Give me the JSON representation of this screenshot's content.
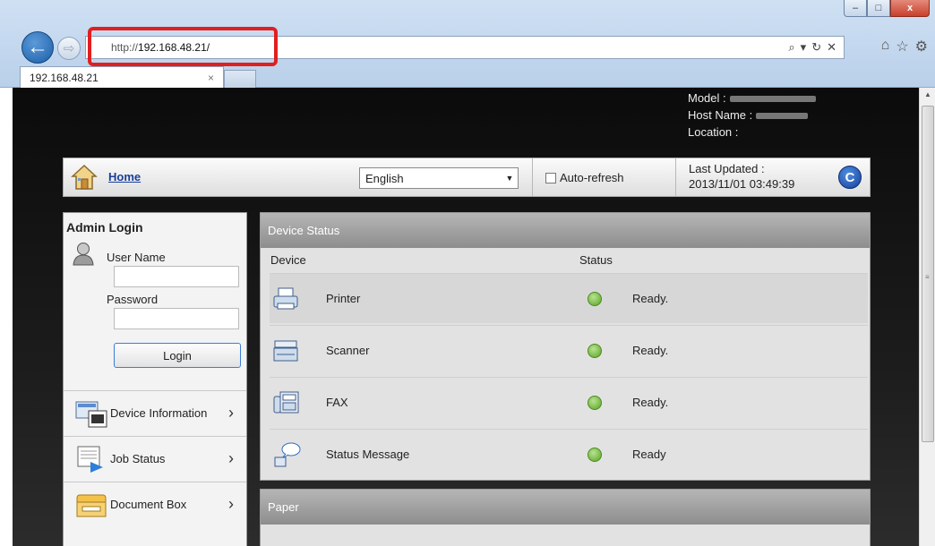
{
  "browser": {
    "url_prefix": "http://",
    "url_host": "192.168.48.21/",
    "tab_title": "192.168.48.21",
    "tab_close": "×",
    "window_buttons": {
      "minimize": "–",
      "maximize": "□",
      "close": "x"
    }
  },
  "device_info": {
    "model_label": "Model :",
    "host_label": "Host Name :",
    "location_label": "Location :"
  },
  "navbar": {
    "home_label": "Home",
    "language": "English",
    "auto_refresh_label": "Auto-refresh",
    "auto_refresh_checked": false,
    "last_updated_label": "Last Updated :",
    "last_updated_value": "2013/11/01 03:49:39"
  },
  "sidebar": {
    "title": "Admin Login",
    "user_name_label": "User Name",
    "password_label": "Password",
    "login_button": "Login",
    "items": [
      {
        "label": "Device Information"
      },
      {
        "label": "Job Status"
      },
      {
        "label": "Document Box"
      }
    ]
  },
  "device_status": {
    "header": "Device Status",
    "col_device": "Device",
    "col_status": "Status",
    "rows": [
      {
        "name": "Printer",
        "status": "Ready."
      },
      {
        "name": "Scanner",
        "status": "Ready."
      },
      {
        "name": "FAX",
        "status": "Ready."
      },
      {
        "name": "Status Message",
        "status": "Ready"
      }
    ],
    "status_color": "#5aa426"
  },
  "paper": {
    "header": "Paper"
  },
  "colors": {
    "highlight": "#e11f1f",
    "link": "#1a3e9a"
  }
}
